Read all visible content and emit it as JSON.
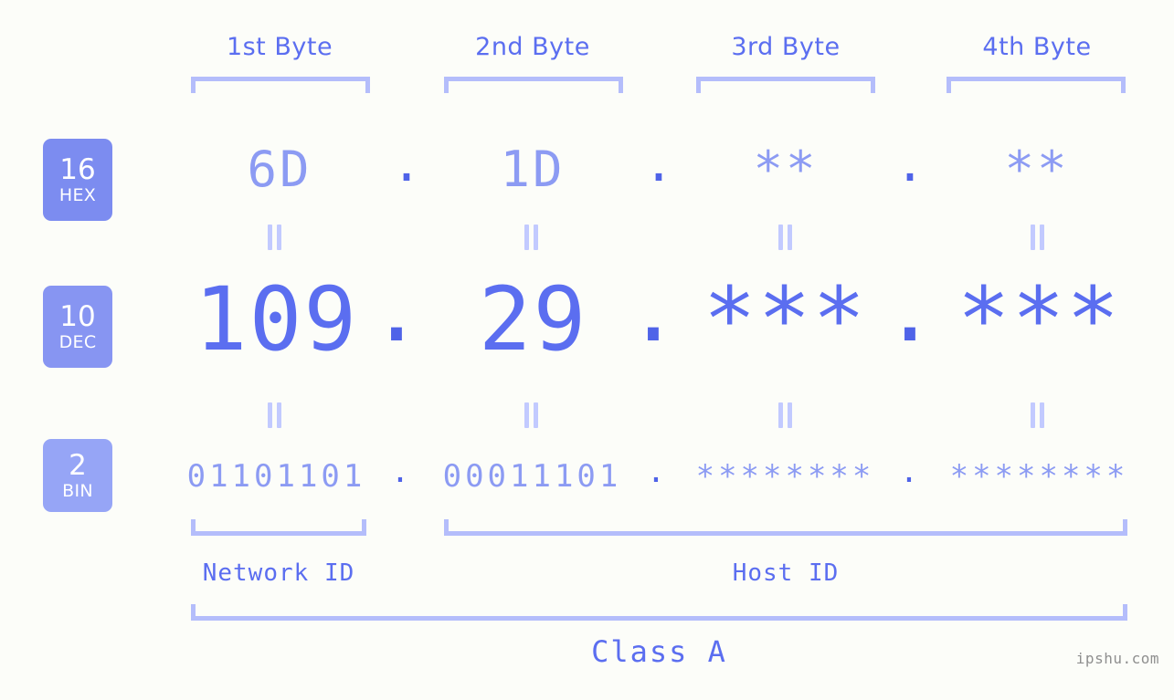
{
  "background_color": "#fcfdf9",
  "accent_color": "#5b6ef0",
  "accent_light_color": "#8c9bf3",
  "bracket_color": "#b4bdfb",
  "headers": {
    "byte1": "1st Byte",
    "byte2": "2nd Byte",
    "byte3": "3rd Byte",
    "byte4": "4th Byte"
  },
  "bases": [
    {
      "number": "16",
      "system": "HEX",
      "color": "#7c8cf0"
    },
    {
      "number": "10",
      "system": "DEC",
      "color": "#8795f2"
    },
    {
      "number": "2",
      "system": "BIN",
      "color": "#96a5f6"
    }
  ],
  "rows": {
    "hex": {
      "base_number": "16",
      "base_system": "HEX",
      "values": [
        "6D",
        "1D",
        "**",
        "**"
      ],
      "separator": "."
    },
    "dec": {
      "base_number": "10",
      "base_system": "DEC",
      "values": [
        "109",
        "29",
        "***",
        "***"
      ],
      "separator": "."
    },
    "bin": {
      "base_number": "2",
      "base_system": "BIN",
      "values": [
        "01101101",
        "00011101",
        "********",
        "********"
      ],
      "separator": "."
    }
  },
  "connectors": {
    "equals": "||"
  },
  "footer": {
    "network_id": "Network ID",
    "host_id": "Host ID",
    "class": "Class A",
    "watermark": "ipshu.com"
  }
}
